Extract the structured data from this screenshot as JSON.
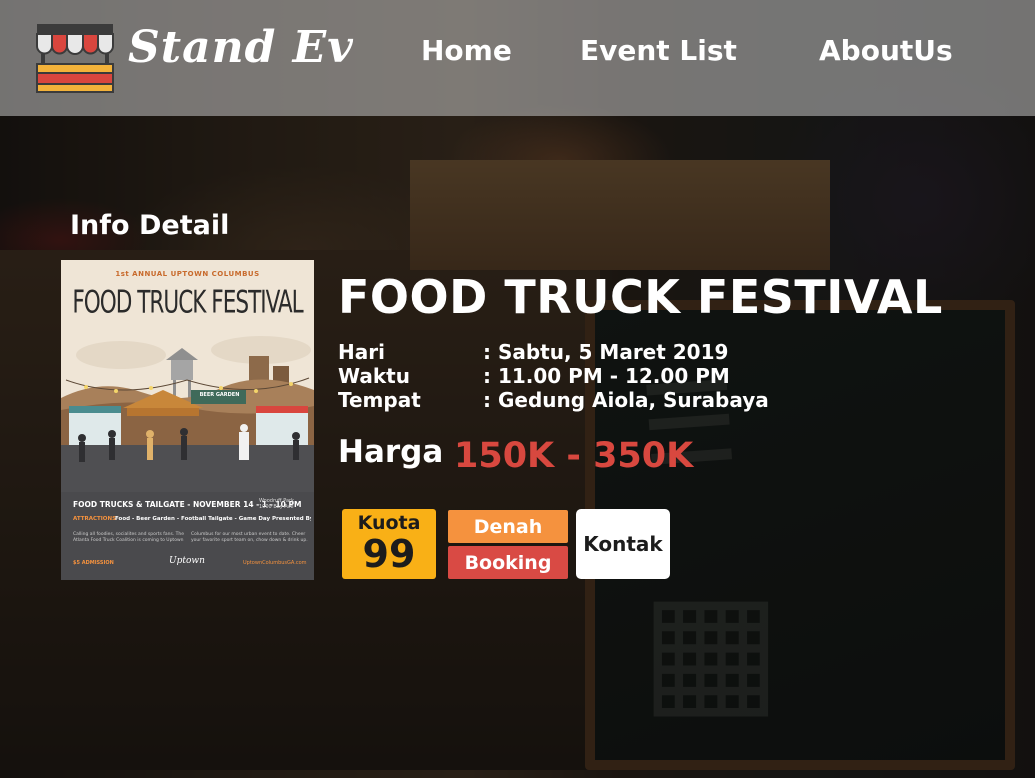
{
  "brand": {
    "name": "Stand Ev",
    "icon": "market-stall-icon"
  },
  "nav": {
    "home": "Home",
    "event_list": "Event List",
    "about": "AboutUs"
  },
  "section_title": "Info Detail",
  "event": {
    "title": "FOOD TRUCK FESTIVAL",
    "details": [
      {
        "label": "Hari",
        "value": ": Sabtu, 5 Maret 2019"
      },
      {
        "label": "Waktu",
        "value": ": 11.00 PM - 12.00 PM"
      },
      {
        "label": "Tempat",
        "value": ": Gedung Aiola, Surabaya"
      }
    ],
    "price_label": "Harga",
    "price_value": "150K - 350K"
  },
  "poster": {
    "kicker": "1st ANNUAL UPTOWN COLUMBUS",
    "title": "FOOD TRUCK FESTIVAL",
    "sign": "BEER GARDEN",
    "headline": "FOOD TRUCKS & TAILGATE - NOVEMBER 14 - 1 - 10 PM",
    "venue": "Woodruff Park\n1000 Bay Ave",
    "attractions_label": "ATTRACTIONS",
    "attractions": "Food - Beer Garden - Football Tailgate - Game Day Presented By TBD",
    "copy_left": "Calling all foodies, socialites and sports fans. The Atlanta Food Truck Coalition is coming to Uptown",
    "copy_right": "Columbus for our most urban event to date. Cheer your favorite sport team on, chow down & drink up.",
    "admission": "$5 ADMISSION",
    "footer_logo": "Uptown",
    "url": "UptownColumbusGA.com"
  },
  "kuota": {
    "label": "Kuota",
    "value": "99"
  },
  "buttons": {
    "denah": "Denah",
    "booking": "Booking",
    "kontak": "Kontak"
  },
  "colors": {
    "price": "#d8483f",
    "kuota_bg": "#f9b016",
    "denah_bg": "#f5923e",
    "booking_bg": "#d94a44",
    "kontak_bg": "#ffffff",
    "navbar_bg": "rgba(196,196,196,0.55)"
  }
}
